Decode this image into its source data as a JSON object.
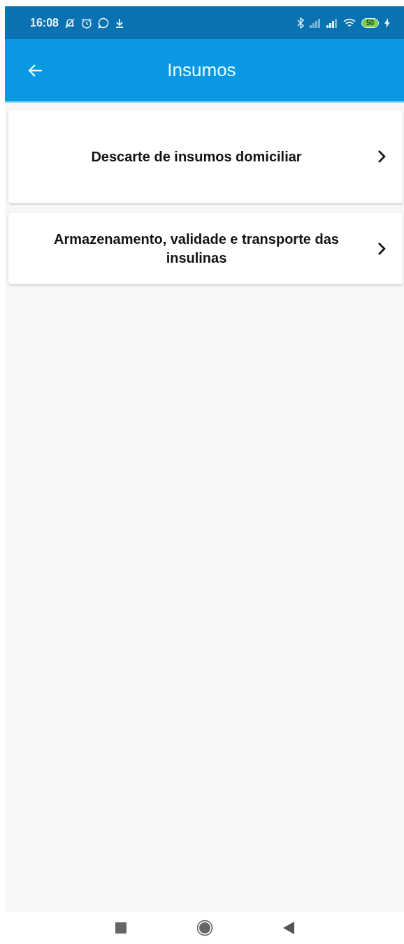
{
  "status_bar": {
    "time": "16:08",
    "battery": "50"
  },
  "app_bar": {
    "title": "Insumos"
  },
  "items": [
    {
      "label": "Descarte de insumos domiciliar"
    },
    {
      "label": "Armazenamento, validade e transporte das insulinas"
    }
  ]
}
